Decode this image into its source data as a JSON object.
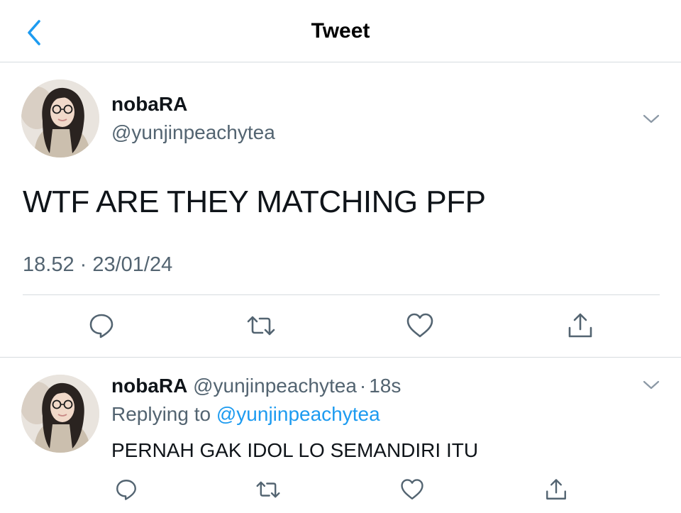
{
  "header": {
    "title": "Tweet",
    "back_icon": "chevron-left-icon"
  },
  "colors": {
    "accent": "#1d9bf0",
    "secondary_text": "#536471",
    "primary_text": "#0f1419",
    "divider": "#d6dbdf"
  },
  "main_tweet": {
    "display_name": "nobaRA",
    "handle": "@yunjinpeachytea",
    "text": "WTF ARE THEY MATCHING PFP",
    "timestamp": "18.52 · 23/01/24",
    "actions": [
      "reply-icon",
      "retweet-icon",
      "like-icon",
      "share-icon"
    ]
  },
  "reply_tweet": {
    "display_name": "nobaRA",
    "handle": "@yunjinpeachytea",
    "separator": "·",
    "time_ago": "18s",
    "replying_to_label": "Replying to",
    "replying_to_handle": "@yunjinpeachytea",
    "text": "PERNAH GAK IDOL LO SEMANDIRI ITU",
    "actions": [
      "reply-icon",
      "retweet-icon",
      "like-icon",
      "share-icon"
    ]
  }
}
